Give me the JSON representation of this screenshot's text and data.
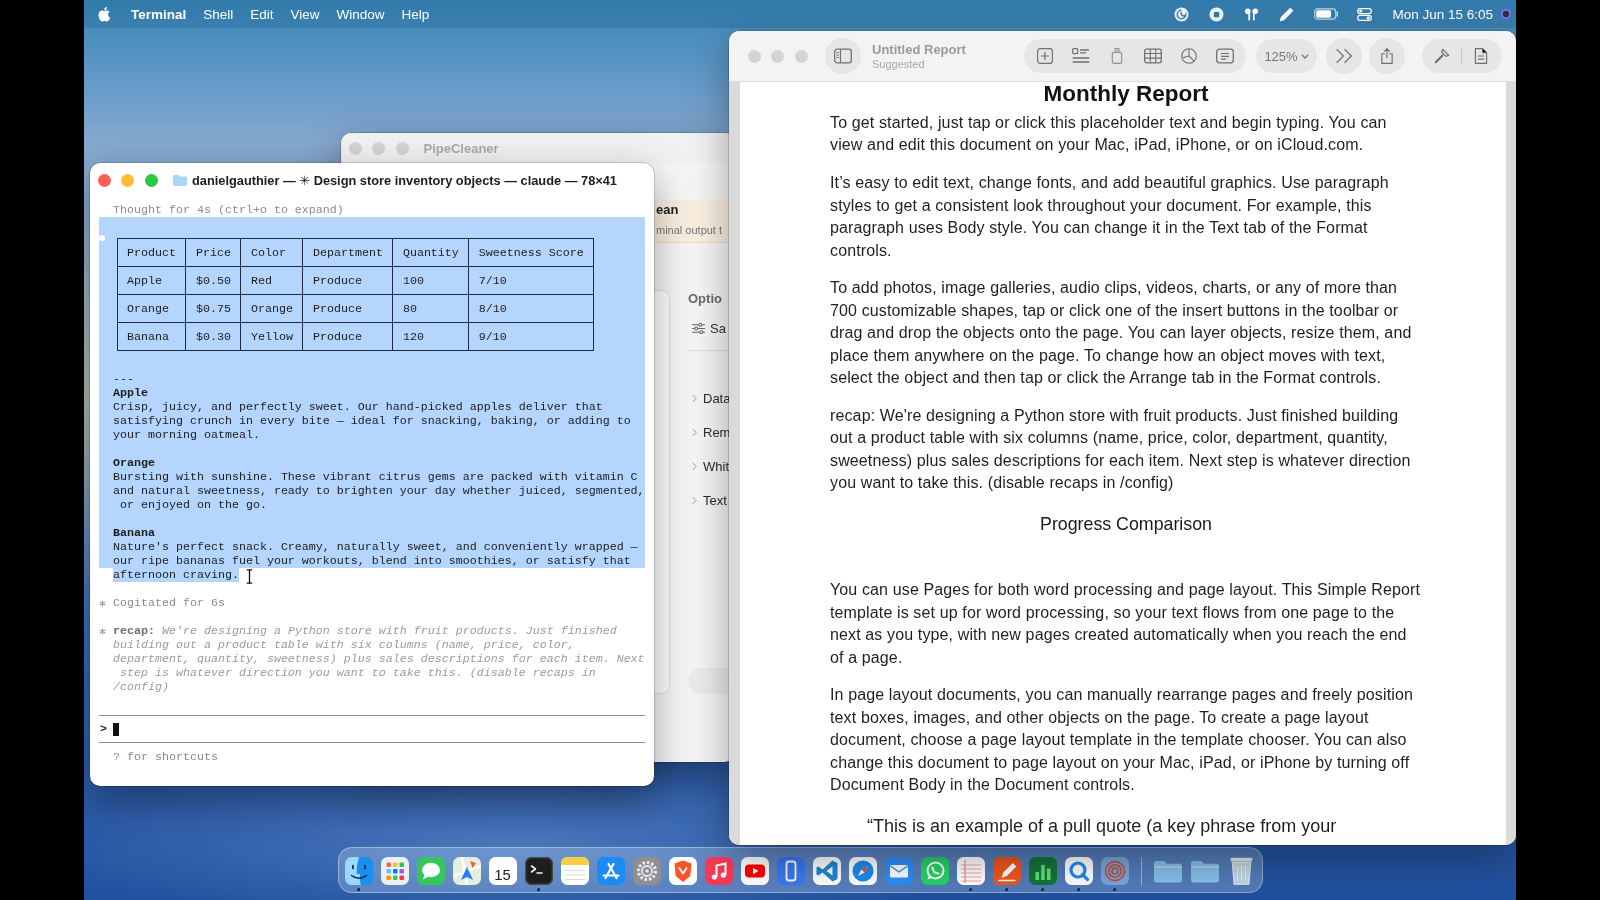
{
  "menu_bar": {
    "app_name": "Terminal",
    "menus": [
      "Shell",
      "Edit",
      "View",
      "Window",
      "Help"
    ],
    "clock": "Mon Jun 15 6:05"
  },
  "pipecleaner_window": {
    "title": "PipeCleaner",
    "active": false,
    "banner": {
      "title": "ean",
      "text": "minal output t"
    },
    "options": {
      "heading": "Optio",
      "setting": "Sa",
      "items": [
        "Data",
        "Rem",
        "Whit",
        "Text"
      ]
    }
  },
  "terminal_window": {
    "title": "danielgauthier — ✳ Design store inventory objects — claude — 78×41",
    "active": true,
    "blocks": [
      {
        "kind": "note",
        "text": "Thought for 4s (ctrl+o to expand)",
        "selected": false
      },
      {
        "kind": "table",
        "selected": true,
        "columns": [
          "Product",
          "Price",
          "Color",
          "Department",
          "Quantity",
          "Sweetness Score"
        ],
        "rows": [
          [
            "Apple",
            "$0.50",
            "Red",
            "Produce",
            "100",
            "7/10"
          ],
          [
            "Orange",
            "$0.75",
            "Orange",
            "Produce",
            "80",
            "8/10"
          ],
          [
            "Banana",
            "$0.30",
            "Yellow",
            "Produce",
            "120",
            "9/10"
          ]
        ]
      },
      {
        "kind": "rule",
        "text": "---",
        "selected": true
      },
      {
        "kind": "section",
        "title": "Apple",
        "text": "Crisp, juicy, and perfectly sweet. Our hand-picked apples deliver that\nsatisfying crunch in every bite — ideal for snacking, baking, or adding to\nyour morning oatmeal.",
        "selected": true
      },
      {
        "kind": "section",
        "title": "Orange",
        "text": "Bursting with sunshine. These vibrant citrus gems are packed with vitamin C\nand natural sweetness, ready to brighten your day whether juiced, segmented,\n or enjoyed on the go.",
        "selected": true
      },
      {
        "kind": "section",
        "title": "Banana",
        "text": "Nature's perfect snack. Creamy, naturally sweet, and conveniently wrapped —\nour ripe bananas fuel your workouts, blend into smoothies, or satisfy that\nafternoon craving.",
        "selected": true
      },
      {
        "kind": "status",
        "text": "Cogitated for 6s",
        "selected": false
      },
      {
        "kind": "recap",
        "text": "**recap:** We're designing a Python store with fruit products. Just finished\nbuilding out a product table with six columns (name, price, color,\ndepartment, quantity, sweetness) plus sales descriptions for each item. Next\n step is whatever direction you want to take this. (disable recaps in\n/config)",
        "selected": false
      }
    ],
    "prompt": ">",
    "hint": "? for shortcuts"
  },
  "pages_window": {
    "title": "Untitled Report",
    "subtitle": "Suggested",
    "active": false,
    "zoom": "125%",
    "document": [
      {
        "kind": "title",
        "text": "Monthly Report"
      },
      {
        "kind": "body",
        "text": "To get started, just tap or click this placeholder text and begin typing. You can view and edit this document on your Mac, iPad, iPhone, or on iCloud.com."
      },
      {
        "kind": "body",
        "text": "It’s easy to edit text, change fonts, and add beautiful graphics. Use paragraph styles to get a consistent look throughout your document. For example, this paragraph uses Body style. You can change it in the Text tab of the Format controls."
      },
      {
        "kind": "body",
        "text": "To add photos, image galleries, audio clips, videos, charts, or any of more than 700 customizable shapes, tap or click one of the insert buttons in the toolbar or drag and drop the objects onto the page. You can layer objects, resize them, and place them anywhere on the page. To change how an object moves with text, select the object and then tap or click the Arrange tab in the Format controls."
      },
      {
        "kind": "body",
        "text": "recap: We're designing a Python store with fruit products. Just finished building out a product table with six columns (name, price, color, department, quantity, sweetness) plus sales descriptions for each item. Next step is whatever direction you want to take this. (disable recaps in /config)"
      },
      {
        "kind": "heading",
        "text": "Progress Comparison"
      },
      {
        "kind": "body",
        "text": "You can use Pages for both word processing and page layout. This Simple Report template is set up for word processing, so your text flows from one page to the next as you type, with new pages created automatically when you reach the end of a page."
      },
      {
        "kind": "body",
        "text": "In page layout documents, you can manually rearrange pages and freely position text boxes, images, and other objects on the page. To create a page layout document, choose a page layout template in the template chooser. You can also change this document to page layout on your Mac, iPad, or iPhone by turning off Document Body in the Document controls."
      },
      {
        "kind": "quote",
        "text": "“This is an example of a pull quote (a key phrase from your"
      }
    ]
  },
  "dock": {
    "apps": [
      {
        "kind": "face",
        "running": true
      },
      {
        "kind": "grid",
        "running": false
      },
      {
        "kind": "bubble",
        "running": false
      },
      {
        "kind": "map",
        "running": false
      },
      {
        "kind": "calendar",
        "text": "15",
        "running": false
      },
      {
        "kind": "prompt",
        "running": true
      },
      {
        "kind": "notepad",
        "running": false
      },
      {
        "kind": "sticks",
        "running": false
      },
      {
        "kind": "gear",
        "running": false
      },
      {
        "kind": "shield",
        "running": false
      },
      {
        "kind": "note",
        "running": false
      },
      {
        "kind": "play",
        "running": false
      },
      {
        "kind": "phone",
        "running": false
      },
      {
        "kind": "ribbon",
        "running": false
      },
      {
        "kind": "compass",
        "running": false
      },
      {
        "kind": "envelope",
        "running": false
      },
      {
        "kind": "chat",
        "running": false
      },
      {
        "kind": "paper",
        "running": true
      },
      {
        "kind": "pen",
        "running": true
      },
      {
        "kind": "bars",
        "running": true
      },
      {
        "kind": "ring",
        "running": true
      },
      {
        "kind": "target",
        "running": true
      }
    ],
    "stacks": [
      {
        "kind": "folder",
        "running": false
      },
      {
        "kind": "folder",
        "running": false
      },
      {
        "kind": "trash",
        "running": false
      }
    ]
  }
}
